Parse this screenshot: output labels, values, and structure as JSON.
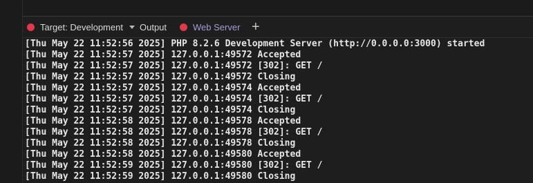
{
  "tabs": {
    "target_label": "Target: Development",
    "output_label": "Output",
    "webserver_label": "Web Server",
    "add_symbol": "+"
  },
  "colors": {
    "status_dot": "#e0394a",
    "active_tab_text": "#a89bd6",
    "console_text": "#e6e6e6",
    "background": "#1e1e1e"
  },
  "console": {
    "lines": [
      "[Thu May 22 11:52:56 2025] PHP 8.2.6 Development Server (http://0.0.0.0:3000) started",
      "[Thu May 22 11:52:57 2025] 127.0.0.1:49572 Accepted",
      "[Thu May 22 11:52:57 2025] 127.0.0.1:49572 [302]: GET /",
      "[Thu May 22 11:52:57 2025] 127.0.0.1:49572 Closing",
      "[Thu May 22 11:52:57 2025] 127.0.0.1:49574 Accepted",
      "[Thu May 22 11:52:57 2025] 127.0.0.1:49574 [302]: GET /",
      "[Thu May 22 11:52:57 2025] 127.0.0.1:49574 Closing",
      "[Thu May 22 11:52:58 2025] 127.0.0.1:49578 Accepted",
      "[Thu May 22 11:52:58 2025] 127.0.0.1:49578 [302]: GET /",
      "[Thu May 22 11:52:58 2025] 127.0.0.1:49578 Closing",
      "[Thu May 22 11:52:58 2025] 127.0.0.1:49580 Accepted",
      "[Thu May 22 11:52:59 2025] 127.0.0.1:49580 [302]: GET /",
      "[Thu May 22 11:52:59 2025] 127.0.0.1:49580 Closing"
    ]
  }
}
